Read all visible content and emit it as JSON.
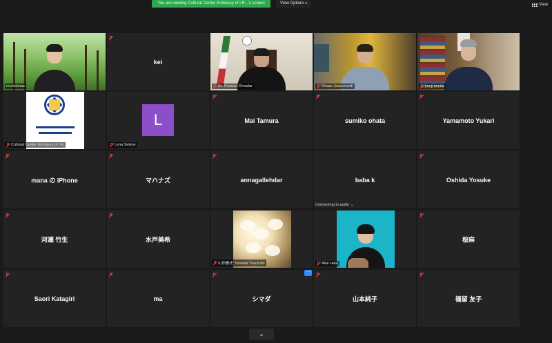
{
  "topbar": {
    "share_banner": "You are viewing Cultural Center Embassy of I.R...'s screen",
    "view_options": "View Options",
    "view_label": "View",
    "colors": {
      "banner": "#2fa84f"
    }
  },
  "participants": [
    {
      "name": "morishmas"
    },
    {
      "name": "kei"
    },
    {
      "name": "Dr. Hossein Divsalar"
    },
    {
      "name": "Ehsan Javanmardi"
    },
    {
      "name": "kenji tomita"
    },
    {
      "name": "Cultural Center Embassy of I.R."
    },
    {
      "name": "Lena Sekine",
      "avatar_letter": "L"
    },
    {
      "name": "Mai Tamura"
    },
    {
      "name": "sumiko ohata"
    },
    {
      "name": "Yamamoto Yukari"
    },
    {
      "name": "mana の iPhone"
    },
    {
      "name": "マハナズ"
    },
    {
      "name": "annagallehdar"
    },
    {
      "name": "baba k",
      "status": "Connecting to audio"
    },
    {
      "name": "Oshida Yosuke"
    },
    {
      "name": "河瀬 竹生"
    },
    {
      "name": "水戸美希"
    },
    {
      "name": "山田泰史 Yamada Yasufumi"
    },
    {
      "name": "Akie Hata"
    },
    {
      "name": "桜麻"
    },
    {
      "name": "Saori Katagiri"
    },
    {
      "name": "ma"
    },
    {
      "name": "シマダ"
    },
    {
      "name": "山本純子"
    },
    {
      "name": "福留 友子"
    }
  ],
  "controls": {
    "more_label": "···",
    "page_down_label": "⌄"
  },
  "icons": {
    "muted": "mic-muted-icon",
    "view": "grid-icon"
  },
  "colors": {
    "active_speaker": "#e3d844",
    "avatar": "#8a4fc9",
    "mute": "#e5484d"
  }
}
